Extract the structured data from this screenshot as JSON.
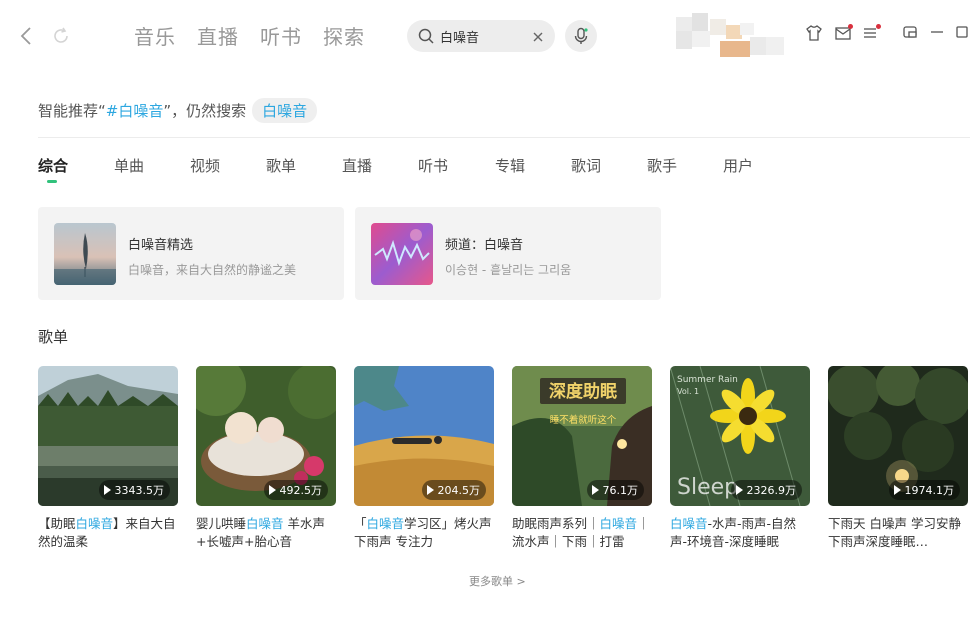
{
  "nav": {
    "tabs": [
      "音乐",
      "直播",
      "听书",
      "探索"
    ]
  },
  "search": {
    "value": "白噪音",
    "placeholder": ""
  },
  "hint": {
    "prefix": "智能推荐“",
    "keyword": "#白噪音",
    "suffix": "”，仍然搜索",
    "original": "白噪音"
  },
  "result_tabs": [
    "综合",
    "单曲",
    "视频",
    "歌单",
    "直播",
    "听书",
    "专辑",
    "歌词",
    "歌手",
    "用户"
  ],
  "cards": [
    {
      "title": "白噪音精选",
      "subtitle": "白噪音，来自大自然的静谧之美"
    },
    {
      "title": "频道：白噪音",
      "subtitle": "이승현 - 흩날리는 그리움"
    }
  ],
  "playlist_section": {
    "title": "歌单",
    "more": "更多歌单 >",
    "items": [
      {
        "count": "3343.5万",
        "title_parts": [
          "【助眠",
          "白噪音",
          "】来自大自然的温柔"
        ]
      },
      {
        "count": "492.5万",
        "title_parts": [
          "婴儿哄睡",
          "白噪音",
          " 羊水声+长嘘声+胎心音"
        ]
      },
      {
        "count": "204.5万",
        "title_parts": [
          "「",
          "白噪音",
          "学习区」烤火声 下雨声 专注力"
        ]
      },
      {
        "count": "76.1万",
        "title_parts": [
          "助眠雨声系列｜",
          "白噪音",
          "｜流水声｜下雨｜打雷"
        ]
      },
      {
        "count": "2326.9万",
        "title_parts": [
          "",
          "白噪音",
          "-水声-雨声-自然声-环境音-深度睡眠"
        ]
      },
      {
        "count": "1974.1万",
        "title_parts": [
          "下雨天 白噪声 学习安静 下雨声深度睡眠…",
          "",
          ""
        ]
      }
    ]
  },
  "cover_texts": {
    "cover4_heading": "深度助眠",
    "cover4_sub": "睡不着就听这个",
    "cover5_top": "Summer Rain",
    "cover5_vol": "Vol. 1",
    "cover5_sleep": "Sleep"
  },
  "colors": {
    "accent_green": "#31c27c",
    "highlight_blue": "#2da7e0",
    "notify_red": "#d9303e"
  }
}
